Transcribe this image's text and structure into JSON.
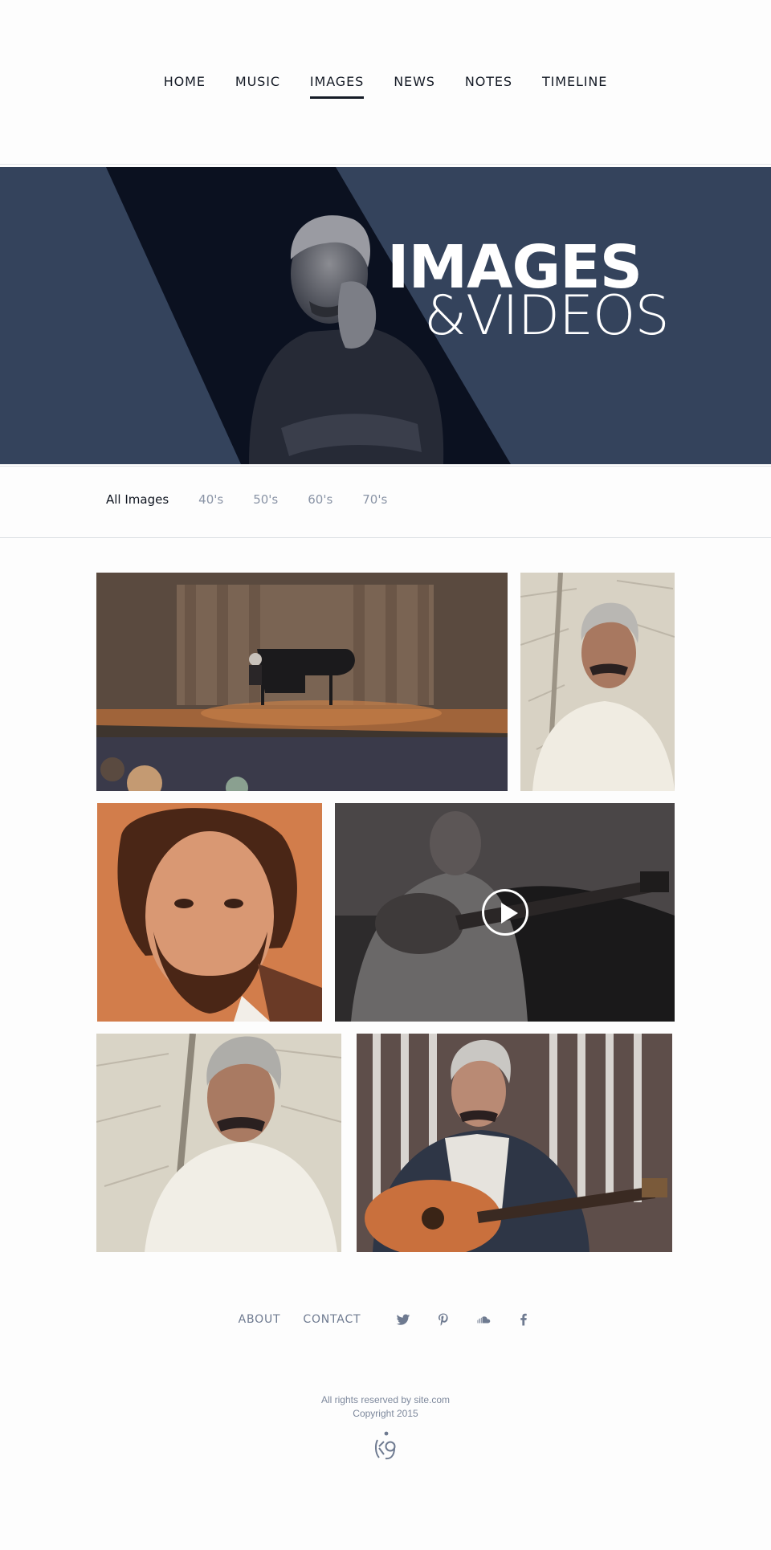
{
  "nav": {
    "items": [
      {
        "label": "HOME"
      },
      {
        "label": "MUSIC"
      },
      {
        "label": "IMAGES",
        "active": true
      },
      {
        "label": "NEWS"
      },
      {
        "label": "NOTES"
      },
      {
        "label": "TIMELINE"
      }
    ]
  },
  "hero": {
    "title": "IMAGES",
    "subtitle": "&VIDEOS"
  },
  "filters": [
    {
      "label": "All Images",
      "active": true
    },
    {
      "label": "40's"
    },
    {
      "label": "50's"
    },
    {
      "label": "60's"
    },
    {
      "label": "70's"
    }
  ],
  "gallery": [
    {
      "kind": "image",
      "subject": "pianist on stage"
    },
    {
      "kind": "image",
      "subject": "portrait white shirt"
    },
    {
      "kind": "image",
      "subject": "close-up portrait"
    },
    {
      "kind": "video",
      "subject": "guitar player"
    },
    {
      "kind": "image",
      "subject": "portrait white shirt seated"
    },
    {
      "kind": "image",
      "subject": "guitarist outdoors"
    }
  ],
  "footer": {
    "links": [
      {
        "label": "ABOUT"
      },
      {
        "label": "CONTACT"
      }
    ],
    "social": [
      {
        "icon": "twitter-icon"
      },
      {
        "icon": "pinterest-icon"
      },
      {
        "icon": "soundcloud-icon"
      },
      {
        "icon": "facebook-icon"
      }
    ],
    "rights": "All rights reserved by site.com",
    "copyright": "Copyright 2015"
  },
  "colors": {
    "accent": "#34435c",
    "dark": "#0b1120",
    "muted": "#8a94a6"
  }
}
